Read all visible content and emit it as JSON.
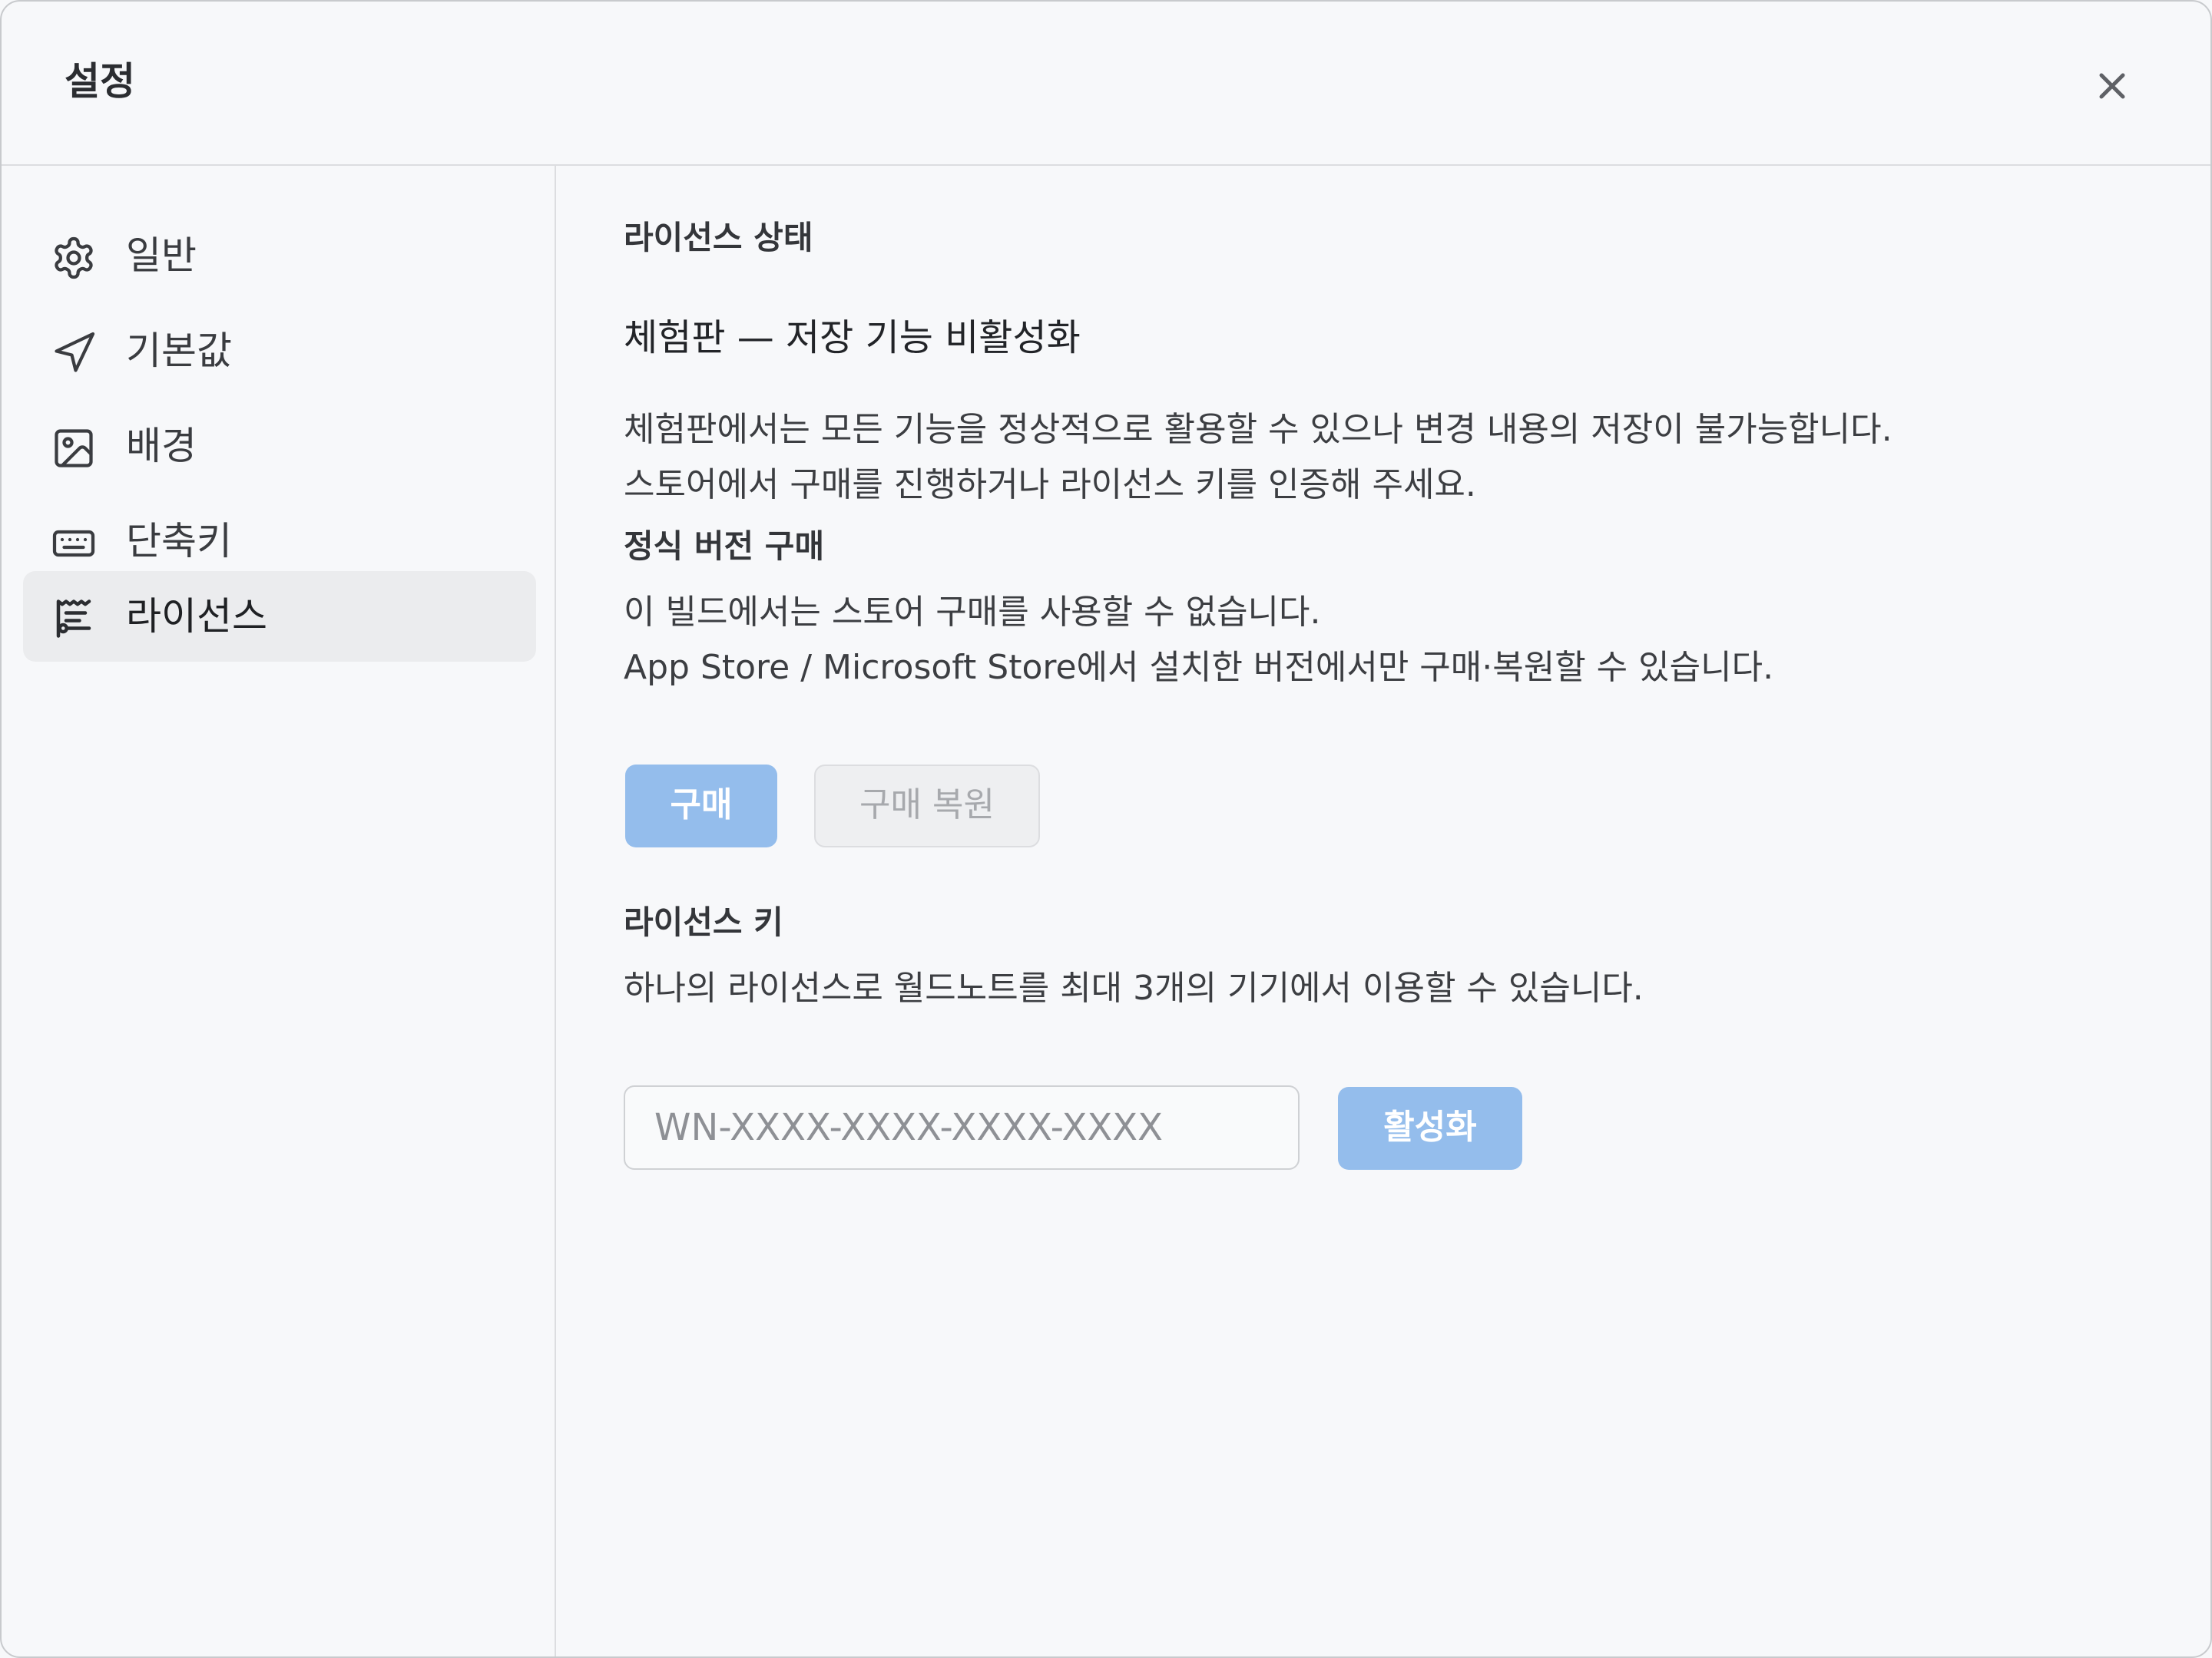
{
  "window": {
    "title": "설정"
  },
  "sidebar": {
    "items": [
      {
        "label": "일반",
        "icon": "gear-icon"
      },
      {
        "label": "기본값",
        "icon": "send-arrow-icon"
      },
      {
        "label": "배경",
        "icon": "image-icon"
      },
      {
        "label": "단축키",
        "icon": "keyboard-icon"
      },
      {
        "label": "라이선스",
        "icon": "receipt-icon",
        "active": true
      }
    ]
  },
  "license": {
    "status_heading": "라이선스 상태",
    "status_line": "체험판 — 저장 기능 비활성화",
    "status_desc_1": "체험판에서는 모든 기능을 정상적으로 활용할 수 있으나 변경 내용의 저장이 불가능합니다.",
    "status_desc_2": "스토어에서 구매를 진행하거나 라이선스 키를 인증해 주세요.",
    "purchase_heading": "정식 버전 구매",
    "purchase_desc_1": "이 빌드에서는 스토어 구매를 사용할 수 없습니다.",
    "purchase_desc_2": "App Store / Microsoft Store에서 설치한 버전에서만 구매·복원할 수 있습니다.",
    "buy_label": "구매",
    "restore_label": "구매 복원",
    "key_heading": "라이선스 키",
    "key_desc": "하나의 라이선스로 월드노트를 최대 3개의 기기에서 이용할 수 있습니다.",
    "key_placeholder": "WN-XXXX-XXXX-XXXX-XXXX",
    "key_value": "",
    "activate_label": "활성화"
  },
  "colors": {
    "accent": "#94bdec",
    "active_nav_bg": "#ebecee",
    "background": "#f7f8fa"
  }
}
